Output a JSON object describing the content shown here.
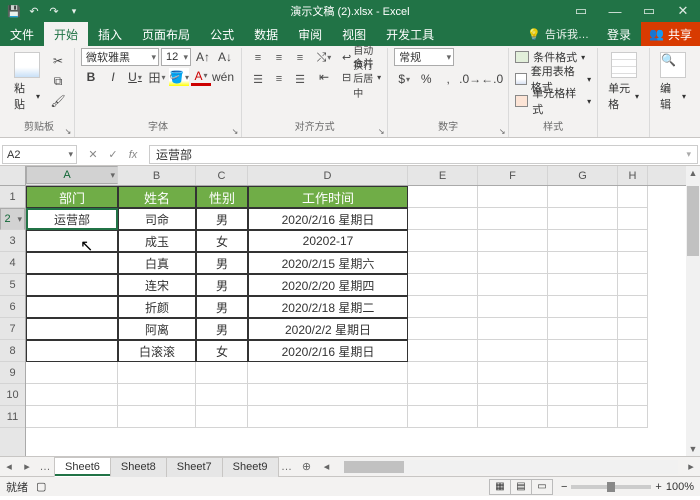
{
  "titlebar": {
    "title": "演示文稿 (2).xlsx - Excel"
  },
  "sysbtns": {
    "min": "—",
    "max": "▭",
    "close": "✕",
    "ribmin": "▭"
  },
  "tabs": [
    "文件",
    "开始",
    "插入",
    "页面布局",
    "公式",
    "数据",
    "审阅",
    "视图",
    "开发工具"
  ],
  "active_tab": 1,
  "tell_me": "告诉我…",
  "login": "登录",
  "share": "共享",
  "groups": {
    "clipboard": {
      "label": "剪贴板",
      "paste": "粘贴"
    },
    "font": {
      "label": "字体",
      "name": "微软雅黑",
      "size": "12",
      "bold": "B",
      "italic": "I",
      "underline": "U",
      "border": "田",
      "fill": "A",
      "color": "A"
    },
    "align": {
      "label": "对齐方式",
      "wrap": "自动换行",
      "merge": "合并后居中"
    },
    "number": {
      "label": "数字",
      "format": "常规"
    },
    "styles": {
      "label": "样式",
      "cond": "条件格式",
      "tablefmt": "套用表格格式",
      "cellfmt": "单元格样式"
    },
    "cells": {
      "label": "单元格",
      "btn": "单元格"
    },
    "editing": {
      "label": "编辑",
      "btn": "编辑"
    }
  },
  "namebox": "A2",
  "formula": "运营部",
  "columns": [
    "A",
    "B",
    "C",
    "D",
    "E",
    "F",
    "G",
    "H"
  ],
  "rows": [
    "1",
    "2",
    "3",
    "4",
    "5",
    "6",
    "7",
    "8",
    "9",
    "10",
    "11"
  ],
  "headers": {
    "A": "部门",
    "B": "姓名",
    "C": "性别",
    "D": "工作时间"
  },
  "data": [
    {
      "A": "运营部",
      "B": "司命",
      "C": "男",
      "D": "2020/2/16 星期日"
    },
    {
      "A": "",
      "B": "成玉",
      "C": "女",
      "D": "20202-17"
    },
    {
      "A": "",
      "B": "白真",
      "C": "男",
      "D": "2020/2/15 星期六"
    },
    {
      "A": "",
      "B": "连宋",
      "C": "男",
      "D": "2020/2/20 星期四"
    },
    {
      "A": "",
      "B": "折颜",
      "C": "男",
      "D": "2020/2/18 星期二"
    },
    {
      "A": "",
      "B": "阿离",
      "C": "男",
      "D": "2020/2/2 星期日"
    },
    {
      "A": "",
      "B": "白滚滚",
      "C": "女",
      "D": "2020/2/16 星期日"
    }
  ],
  "sheets": [
    "Sheet6",
    "Sheet8",
    "Sheet7",
    "Sheet9"
  ],
  "active_sheet": 0,
  "status": {
    "ready": "就绪",
    "zoom": "100%",
    "minus": "−",
    "plus": "+"
  }
}
